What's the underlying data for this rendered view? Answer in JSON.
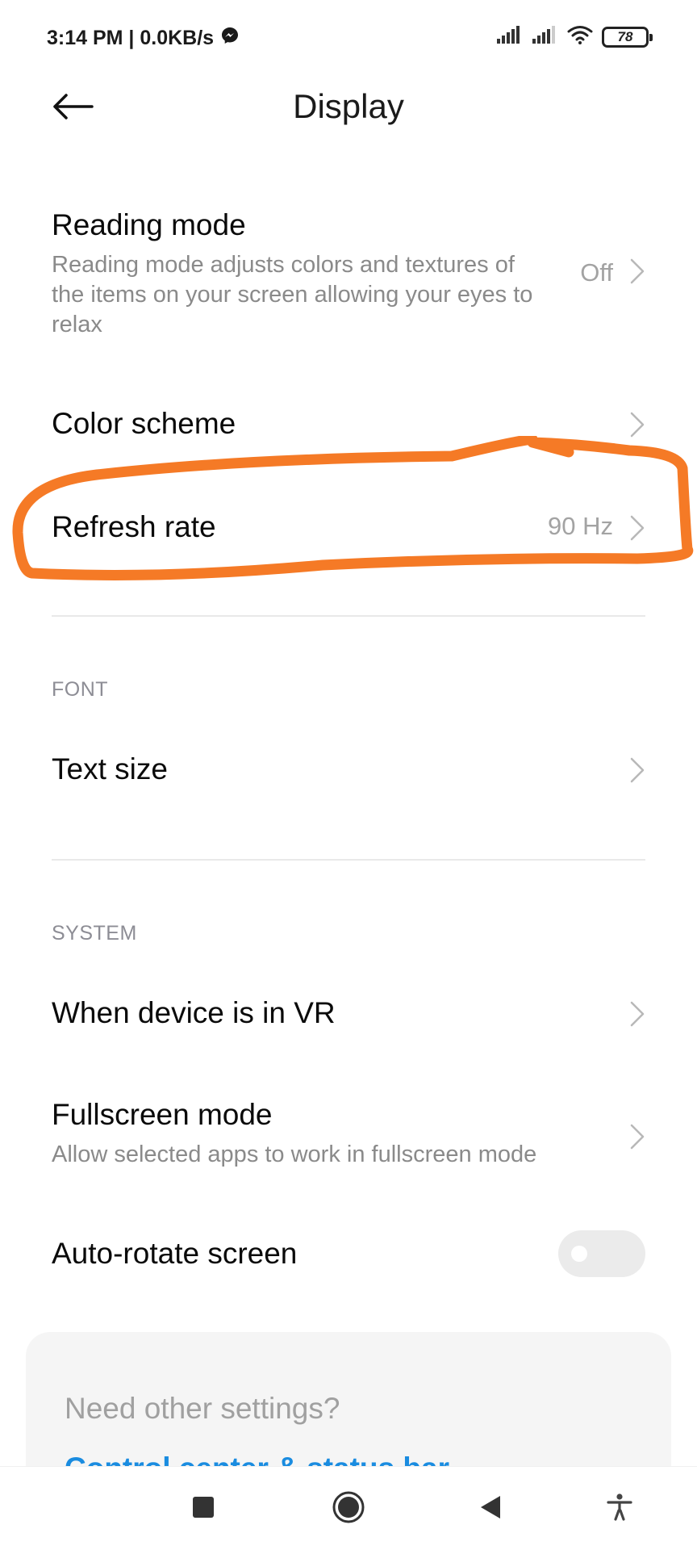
{
  "status_bar": {
    "time_speed": "3:14 PM | 0.0KB/s",
    "battery": "78",
    "icons": [
      "messenger-icon",
      "signal-icon",
      "signal-icon",
      "wifi-icon",
      "battery-icon"
    ]
  },
  "header": {
    "title": "Display",
    "back_icon": "arrow-left-icon"
  },
  "rows": {
    "reading_mode": {
      "title": "Reading mode",
      "description": "Reading mode adjusts colors and textures of the items on your screen allowing your eyes to relax",
      "value": "Off"
    },
    "color_scheme": {
      "title": "Color scheme"
    },
    "refresh_rate": {
      "title": "Refresh rate",
      "value": "90 Hz"
    },
    "text_size": {
      "title": "Text size"
    },
    "vr": {
      "title": "When device is in VR"
    },
    "fullscreen": {
      "title": "Fullscreen mode",
      "description": "Allow selected apps to work in fullscreen mode"
    },
    "auto_rotate": {
      "title": "Auto-rotate screen",
      "enabled": false
    }
  },
  "sections": {
    "font": "FONT",
    "system": "SYSTEM"
  },
  "card": {
    "title": "Need other settings?",
    "link": "Control center & status bar"
  },
  "annotation": {
    "color": "#f57a26"
  },
  "nav_bar": {
    "icons": [
      "recents-square-icon",
      "home-circle-icon",
      "back-triangle-icon",
      "accessibility-icon"
    ]
  }
}
